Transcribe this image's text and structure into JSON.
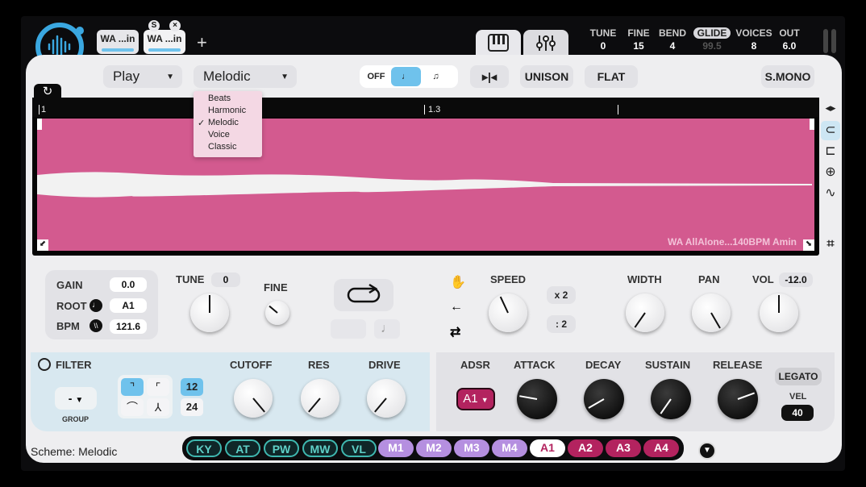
{
  "tabs": [
    {
      "label": "WA ...in"
    },
    {
      "label": "WA ...in",
      "badge": "S",
      "close": "×"
    }
  ],
  "add_tab": "+",
  "header": {
    "tune": {
      "label": "TUNE",
      "value": "0"
    },
    "fine": {
      "label": "FINE",
      "value": "15"
    },
    "bend": {
      "label": "BEND",
      "value": "4"
    },
    "glide": {
      "label": "GLIDE",
      "value": "99.5"
    },
    "voices": {
      "label": "VOICES",
      "value": "8"
    },
    "out": {
      "label": "OUT",
      "value": "6.0"
    }
  },
  "toolbar": {
    "mode": "Play",
    "algorithm": "Melodic",
    "off": "OFF",
    "unison": "UNISON",
    "flat": "FLAT",
    "smono": "S.MONO"
  },
  "algo_menu": [
    "Beats",
    "Harmonic",
    "Melodic",
    "Voice",
    "Classic"
  ],
  "algo_selected": "Melodic",
  "ruler": {
    "m1": "1",
    "m2": "1.3"
  },
  "sample_name": "WA AllAlone...140BPM Amin",
  "params": {
    "gain": {
      "label": "GAIN",
      "value": "0.0"
    },
    "root": {
      "label": "ROOT",
      "value": "A1"
    },
    "bpm": {
      "label": "BPM",
      "value": "121.6"
    }
  },
  "knobs": {
    "tune": {
      "label": "TUNE",
      "value": "0"
    },
    "fine": {
      "label": "FINE"
    },
    "speed": {
      "label": "SPEED"
    },
    "x2": "x 2",
    "div2": ": 2",
    "width": {
      "label": "WIDTH"
    },
    "pan": {
      "label": "PAN"
    },
    "vol": {
      "label": "VOL",
      "value": "-12.0"
    }
  },
  "filter": {
    "label": "FILTER",
    "group_value": "-",
    "group_label": "GROUP",
    "slope12": "12",
    "slope24": "24",
    "cutoff": "CUTOFF",
    "res": "RES",
    "drive": "DRIVE"
  },
  "adsr": {
    "label": "ADSR",
    "target": "A1",
    "attack": "ATTACK",
    "decay": "DECAY",
    "sustain": "SUSTAIN",
    "release": "RELEASE",
    "legato": "LEGATO",
    "vel_label": "VEL",
    "vel_value": "40"
  },
  "bottom_chips": [
    "KY",
    "AT",
    "PW",
    "MW",
    "VL",
    "M1",
    "M2",
    "M3",
    "M4",
    "A1",
    "A2",
    "A3",
    "A4"
  ],
  "scheme": "Scheme: Melodic",
  "colors": {
    "accent": "#6fc2ec",
    "wave": "#d35a8f",
    "adsr_red": "#b3235f",
    "mod_purple": "#b58fe0",
    "key_teal": "#3fb8b0"
  }
}
